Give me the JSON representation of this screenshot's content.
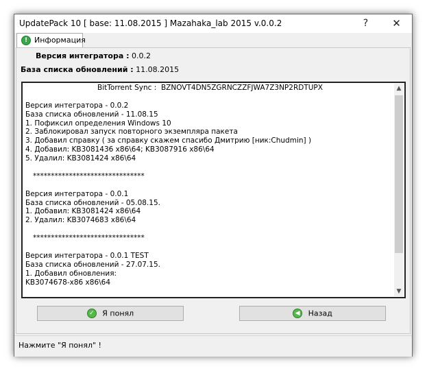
{
  "window": {
    "title": "UpdatePack 10 [ base: 11.08.2015 ] Mazahaka_lab 2015 v.0.0.2",
    "help_glyph": "?",
    "close_glyph": "✕"
  },
  "tabs": [
    {
      "label": "Информация",
      "icon": "info-icon"
    }
  ],
  "info": {
    "integrator_label": "Версия интегратора :",
    "integrator_value": "0.0.2",
    "base_label": "База списка обновлений :",
    "base_value": "11.08.2015"
  },
  "changelog": {
    "lines": [
      "BitTorrent Sync :  BZNOVT4DN5ZGRNCZZFJWA7Z3NP2RDTUPX",
      "",
      "Версия интегратора - 0.0.2",
      "База списка обновлений - 11.08.15",
      "1. Пофиксил определения Windows 10",
      "2. Заблокировал запуск повторного экземпляра пакета",
      "3. Добавил справку ( за справку скажем спасибо Дмитрию [ник:Chudmin] )",
      "4. Добавил: KB3081436 x86\\64; KB3087916 x86\\64",
      "5. Удалил: KB3081424 x86\\64",
      "",
      "*******************************",
      "",
      "Версия интегратора - 0.0.1",
      "База списка обновлений - 05.08.15.",
      "1. Добавил: KB3081424 x86\\64",
      "2. Удалил: KB3074683 x86\\64",
      "",
      "*******************************",
      "",
      "Версия интегратора - 0.0.1 TEST",
      "База списка обновлений - 27.07.15.",
      "1. Добавил обновления:",
      "KB3074678-x86 x86\\64"
    ]
  },
  "buttons": {
    "ok_label": "Я понял",
    "back_label": "Назад"
  },
  "status": {
    "text": "Нажмите \"Я понял\" !"
  },
  "colors": {
    "accent_green": "#55b84a"
  }
}
